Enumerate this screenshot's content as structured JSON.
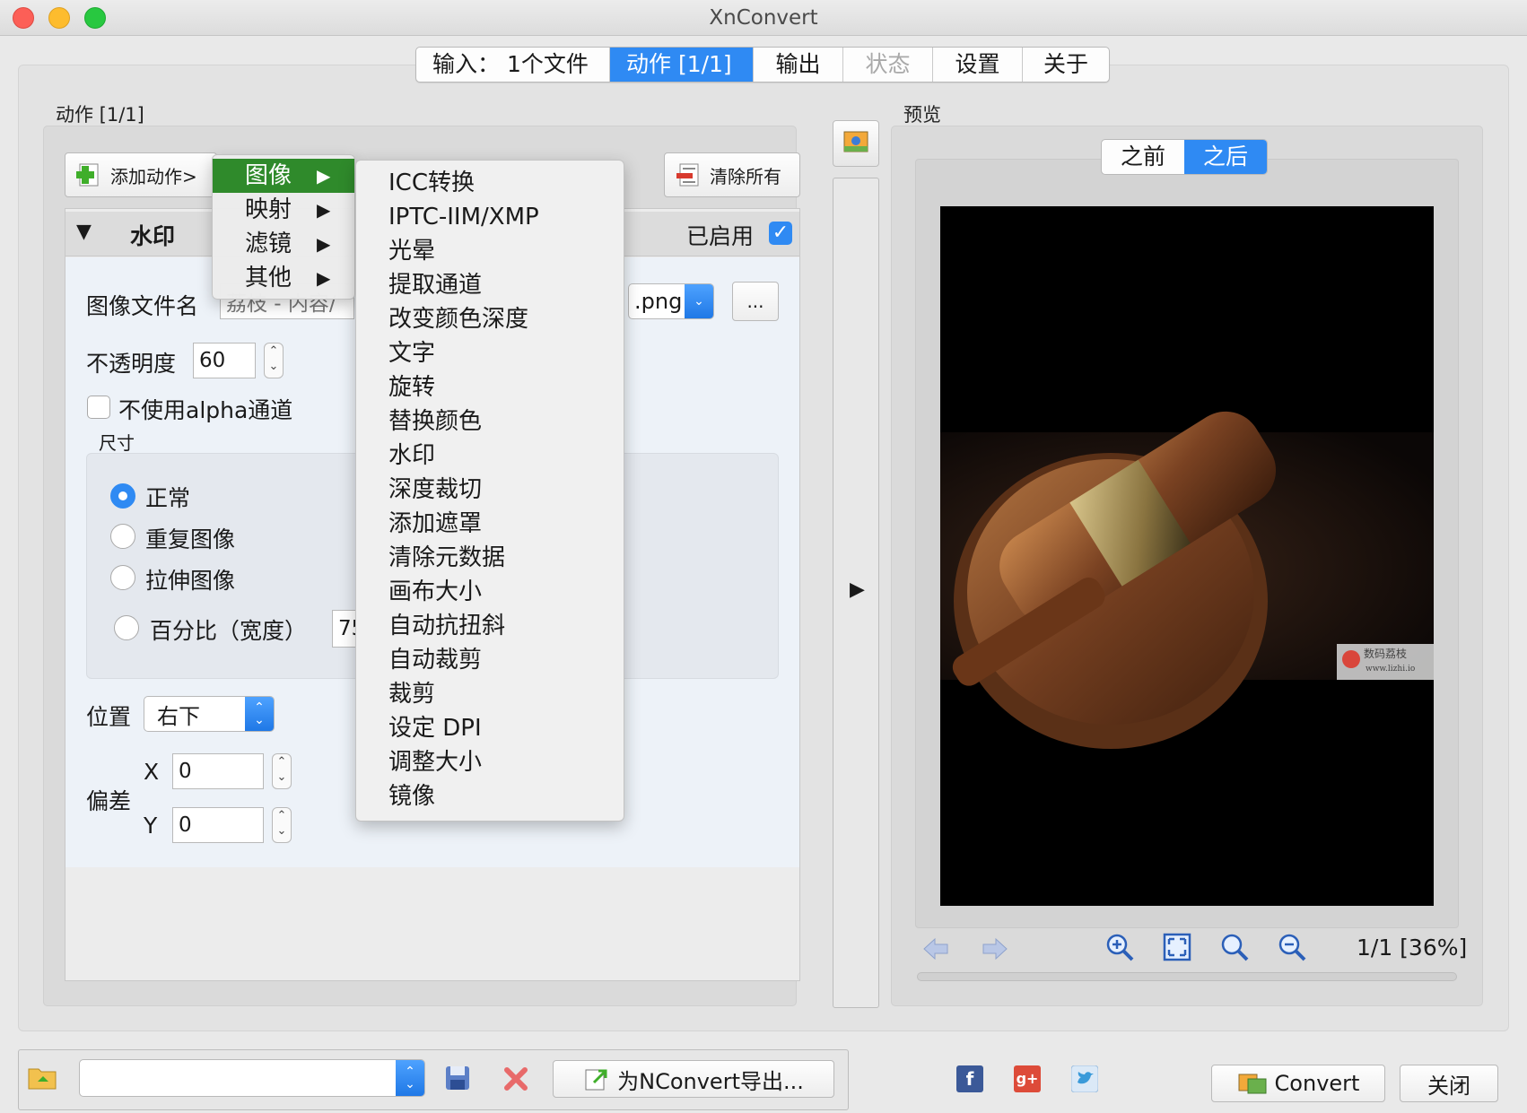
{
  "window": {
    "title": "XnConvert"
  },
  "tabs": [
    {
      "label": "输入：  1个文件",
      "state": "normal"
    },
    {
      "label": "动作 [1/1]",
      "state": "active"
    },
    {
      "label": "输出",
      "state": "normal"
    },
    {
      "label": "状态",
      "state": "disabled"
    },
    {
      "label": "设置",
      "state": "normal"
    },
    {
      "label": "关于",
      "state": "normal"
    }
  ],
  "actions": {
    "section_label": "动作 [1/1]",
    "add_button": "添加动作>",
    "clear_button": "清除所有",
    "watermark": {
      "title": "水印",
      "enabled_label": "已启用",
      "enabled": true,
      "image_filename_label": "图像文件名",
      "image_filename_visible_prefix": "荔枝 - 内容/",
      "image_filename_suffix": ".png",
      "browse_button": "...",
      "opacity_label": "不透明度",
      "opacity_value": "60",
      "no_alpha_label": "不使用alpha通道",
      "size_label": "尺寸",
      "size_options": [
        "正常",
        "重复图像",
        "拉伸图像",
        "百分比（宽度）"
      ],
      "size_selected": "正常",
      "percent_value_visible": "75",
      "position_label": "位置",
      "position_value": "右下",
      "offset_label": "偏差",
      "x_label": "X",
      "x_value": "0",
      "y_label": "Y",
      "y_value": "0"
    }
  },
  "menu": {
    "level1": [
      {
        "label": "图像",
        "highlighted": true
      },
      {
        "label": "映射",
        "highlighted": false
      },
      {
        "label": "滤镜",
        "highlighted": false
      },
      {
        "label": "其他",
        "highlighted": false
      }
    ],
    "level2": [
      "ICC转换",
      "IPTC-IIM/XMP",
      "光晕",
      "提取通道",
      "改变颜色深度",
      "文字",
      "旋转",
      "替换颜色",
      "水印",
      "深度裁切",
      "添加遮罩",
      "清除元数据",
      "画布大小",
      "自动抗扭斜",
      "自动裁剪",
      "裁剪",
      "设定 DPI",
      "调整大小",
      "镜像"
    ],
    "arrow": "▶"
  },
  "preview": {
    "section_label": "预览",
    "segments": [
      {
        "label": "之前",
        "active": false
      },
      {
        "label": "之后",
        "active": true
      }
    ],
    "watermark_text": "数码荔枝",
    "watermark_url": "www.lizhi.io",
    "page_info": "1/1 [36%]"
  },
  "bottom": {
    "export_button": "为NConvert导出...",
    "convert_button": "Convert",
    "close_button": "关闭"
  },
  "colors": {
    "accent": "#2f8af3",
    "menu_highlight": "#2f8a2b"
  }
}
